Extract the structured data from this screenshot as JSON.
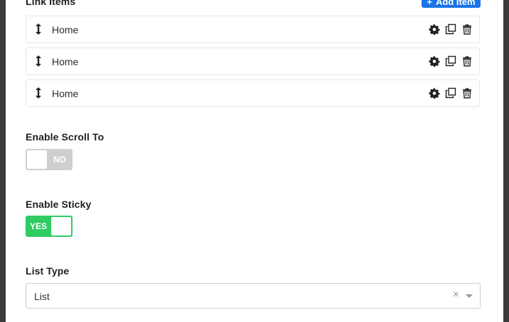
{
  "link_items": {
    "title": "Link Items",
    "add_button_label": "Add Item",
    "add_button_icon": "plus-icon",
    "items": [
      {
        "label": "Home"
      },
      {
        "label": "Home"
      },
      {
        "label": "Home"
      }
    ],
    "item_action_icons": [
      "gear-icon",
      "copy-icon",
      "trash-icon"
    ]
  },
  "enable_scroll_to": {
    "label": "Enable Scroll To",
    "state_text": "NO",
    "enabled": false
  },
  "enable_sticky": {
    "label": "Enable Sticky",
    "state_text": "YES",
    "enabled": true
  },
  "list_type": {
    "label": "List Type",
    "value": "List",
    "clear_glyph": "×"
  },
  "colors": {
    "accent_blue": "#1a73e8",
    "toggle_on": "#2ecc63",
    "toggle_off": "#cfcfcf"
  }
}
